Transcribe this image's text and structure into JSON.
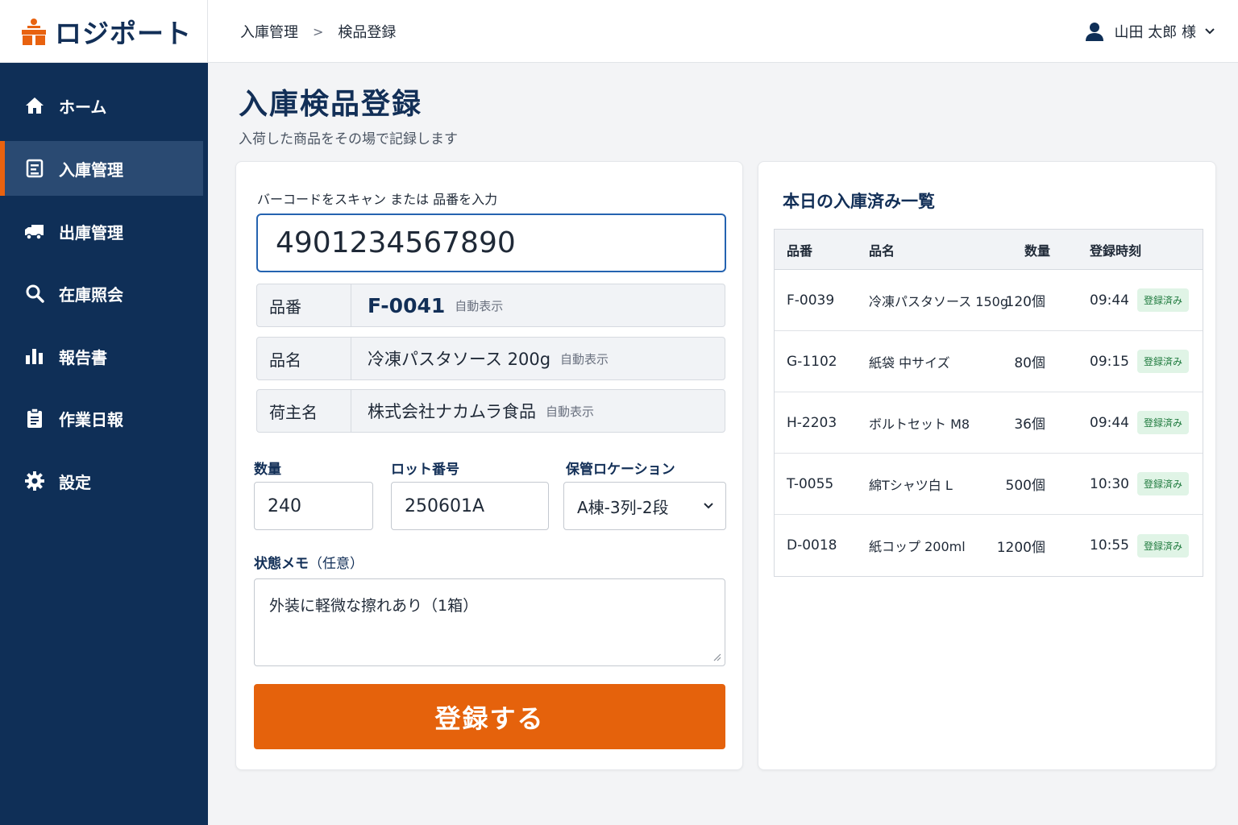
{
  "app": {
    "name": "ロジポート"
  },
  "breadcrumb": {
    "parent": "入庫管理",
    "separator": ">",
    "current": "検品登録"
  },
  "user": {
    "name": "山田 太郎 様"
  },
  "sidebar": {
    "items": [
      {
        "label": "ホーム",
        "icon": "home-icon"
      },
      {
        "label": "入庫管理",
        "icon": "receipt-icon",
        "active": true
      },
      {
        "label": "出庫管理",
        "icon": "truck-icon"
      },
      {
        "label": "在庫照会",
        "icon": "search-icon"
      },
      {
        "label": "報告書",
        "icon": "bar-chart-icon"
      },
      {
        "label": "作業日報",
        "icon": "clipboard-icon"
      },
      {
        "label": "設定",
        "icon": "gear-icon"
      }
    ]
  },
  "page": {
    "title": "入庫検品登録",
    "subtitle": "入荷した商品をその場で記録します"
  },
  "form": {
    "scan_label": "バーコードをスキャン または 品番を入力",
    "scan_value": "4901234567890",
    "auto_label": "自動表示",
    "info": [
      {
        "key": "品番",
        "value": "F-0041"
      },
      {
        "key": "品名",
        "value": "冷凍パスタソース 200g"
      },
      {
        "key": "荷主名",
        "value": "株式会社ナカムラ食品"
      }
    ],
    "qty_label": "数量",
    "qty_value": "240",
    "lot_label": "ロット番号",
    "lot_value": "250601A",
    "location_label": "保管ロケーション",
    "location_value": "A棟-3列-2段",
    "memo_label": "状態メモ",
    "memo_optional": "（任意）",
    "memo_value": "外装に軽微な擦れあり（1箱）",
    "submit_label": "登録する"
  },
  "today_list": {
    "title": "本日の入庫済み一覧",
    "columns": [
      "品番",
      "品名",
      "数量",
      "登録時刻"
    ],
    "rows": [
      {
        "code": "F-0039",
        "name": "冷凍パスタソース 150g",
        "qty": "120個",
        "time": "09:44",
        "status": "登録済み"
      },
      {
        "code": "G-1102",
        "name": "紙袋 中サイズ",
        "qty": "80個",
        "time": "09:15",
        "status": "登録済み"
      },
      {
        "code": "H-2203",
        "name": "ボルトセット M8",
        "qty": "36個",
        "time": "09:44",
        "status": "登録済み"
      },
      {
        "code": "T-0055",
        "name": "綿Tシャツ白 L",
        "qty": "500個",
        "time": "10:30",
        "status": "登録済み"
      },
      {
        "code": "D-0018",
        "name": "紙コップ 200ml",
        "qty": "1200個",
        "time": "10:55",
        "status": "登録済み"
      }
    ]
  },
  "colors": {
    "navy": "#0f2f57",
    "accent": "#e5620c",
    "active_nav": "#2a4a72",
    "badge_bg": "#e0f4e6",
    "badge_text": "#1f7a3e"
  }
}
